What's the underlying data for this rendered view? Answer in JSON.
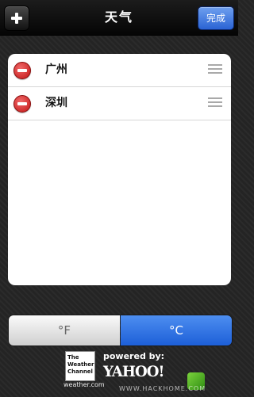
{
  "navbar": {
    "title": "天气",
    "done_label": "完成",
    "add_icon": "plus-icon"
  },
  "cities": [
    {
      "name": "广州",
      "delete_icon": "minus-circle-icon",
      "reorder_icon": "grip-icon"
    },
    {
      "name": "深圳",
      "delete_icon": "minus-circle-icon",
      "reorder_icon": "grip-icon"
    }
  ],
  "units": {
    "fahrenheit": "°F",
    "celsius": "°C",
    "selected": "celsius"
  },
  "footer": {
    "twc_logo_lines": [
      "The",
      "Weather",
      "Channel"
    ],
    "twc_url": "weather.com",
    "powered_by": "powered by:",
    "yahoo": "YAHOO!",
    "watermark_site": "WWW.HACKHOME.COM"
  },
  "colors": {
    "accent_blue": "#2a63d4",
    "delete_red": "#c21414"
  }
}
